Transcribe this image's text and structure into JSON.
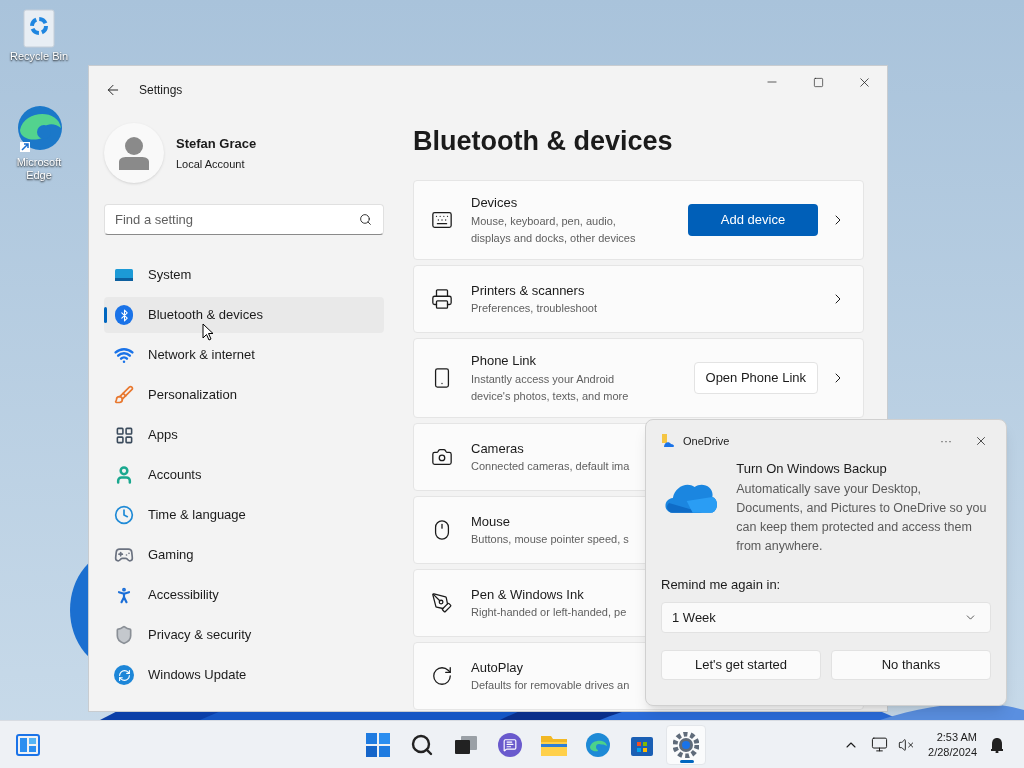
{
  "desktop_icons": [
    {
      "label": "Recycle Bin"
    },
    {
      "label": "Microsoft Edge"
    }
  ],
  "settings": {
    "title": "Settings",
    "user": {
      "name": "Stefan Grace",
      "account": "Local Account"
    },
    "search": {
      "placeholder": "Find a setting"
    },
    "nav": [
      {
        "label": "System",
        "selected": false
      },
      {
        "label": "Bluetooth & devices",
        "selected": true
      },
      {
        "label": "Network & internet",
        "selected": false
      },
      {
        "label": "Personalization",
        "selected": false
      },
      {
        "label": "Apps",
        "selected": false
      },
      {
        "label": "Accounts",
        "selected": false
      },
      {
        "label": "Time & language",
        "selected": false
      },
      {
        "label": "Gaming",
        "selected": false
      },
      {
        "label": "Accessibility",
        "selected": false
      },
      {
        "label": "Privacy & security",
        "selected": false
      },
      {
        "label": "Windows Update",
        "selected": false
      }
    ],
    "heading": "Bluetooth & devices",
    "cards": [
      {
        "title": "Devices",
        "description": "Mouse, keyboard, pen, audio, displays and docks, other devices",
        "action": {
          "label": "Add device",
          "kind": "primary"
        },
        "chevron": true
      },
      {
        "title": "Printers & scanners",
        "description": "Preferences, troubleshoot",
        "chevron": true
      },
      {
        "title": "Phone Link",
        "description": "Instantly access your Android device's photos, texts, and more",
        "action": {
          "label": "Open Phone Link",
          "kind": "secondary"
        },
        "chevron": true
      },
      {
        "title": "Cameras",
        "description": "Connected cameras, default ima"
      },
      {
        "title": "Mouse",
        "description": "Buttons, mouse pointer speed, s"
      },
      {
        "title": "Pen & Windows Ink",
        "description": "Right-handed or left-handed, pe"
      },
      {
        "title": "AutoPlay",
        "description": "Defaults for removable drives an"
      }
    ]
  },
  "popup": {
    "app": "OneDrive",
    "more": "···",
    "title": "Turn On Windows Backup",
    "body": "Automatically save your Desktop, Documents, and Pictures to OneDrive so you can keep them protected and access them from anywhere.",
    "remind_label": "Remind me again in:",
    "select": {
      "value": "1 Week"
    },
    "buttons": [
      "Let's get started",
      "No thanks"
    ]
  },
  "taskbar": {
    "apps": [
      {
        "selected": false
      },
      {
        "selected": false
      },
      {
        "selected": false
      },
      {
        "selected": false
      },
      {
        "selected": false
      },
      {
        "selected": false
      },
      {
        "selected": false
      },
      {
        "selected": true
      }
    ],
    "time": "2:53 AM",
    "date": "2/28/2024"
  }
}
